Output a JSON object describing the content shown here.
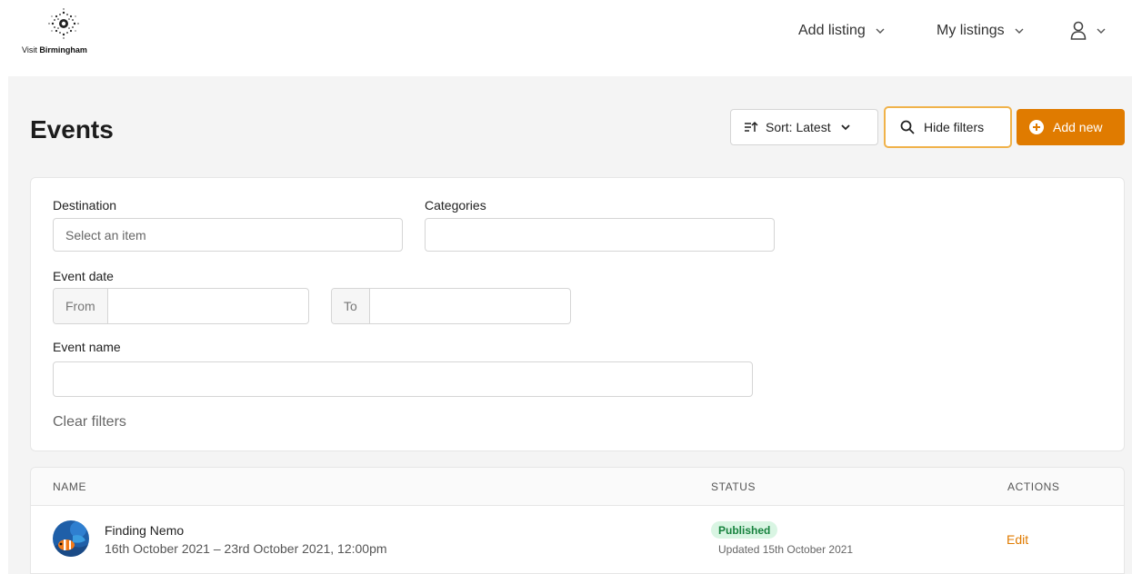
{
  "brand": {
    "name_prefix": "Visit ",
    "name_bold": "Birmingham"
  },
  "nav": {
    "add_listing": "Add listing",
    "my_listings": "My listings",
    "user_icon": "user-icon"
  },
  "page": {
    "title": "Events",
    "sort_label": "Sort: Latest",
    "hide_filters_label": "Hide filters",
    "add_new_label": "Add new"
  },
  "filters": {
    "destination_label": "Destination",
    "destination_placeholder": "Select an item",
    "categories_label": "Categories",
    "categories_value": "",
    "event_date_label": "Event date",
    "from_label": "From",
    "to_label": "To",
    "from_value": "",
    "to_value": "",
    "event_name_label": "Event name",
    "event_name_value": "",
    "clear_label": "Clear filters"
  },
  "table": {
    "columns": [
      "NAME",
      "STATUS",
      "ACTIONS"
    ],
    "rows": [
      {
        "name": "Finding Nemo",
        "dates": "16th October 2021 – 23rd October 2021, 12:00pm",
        "status": "Published",
        "updated": "Updated 15th October 2021",
        "action": "Edit"
      }
    ]
  },
  "colors": {
    "accent": "#e07b00",
    "focus_ring": "#f0b24a",
    "published_bg": "#d9f5e3",
    "published_text": "#17823e"
  }
}
